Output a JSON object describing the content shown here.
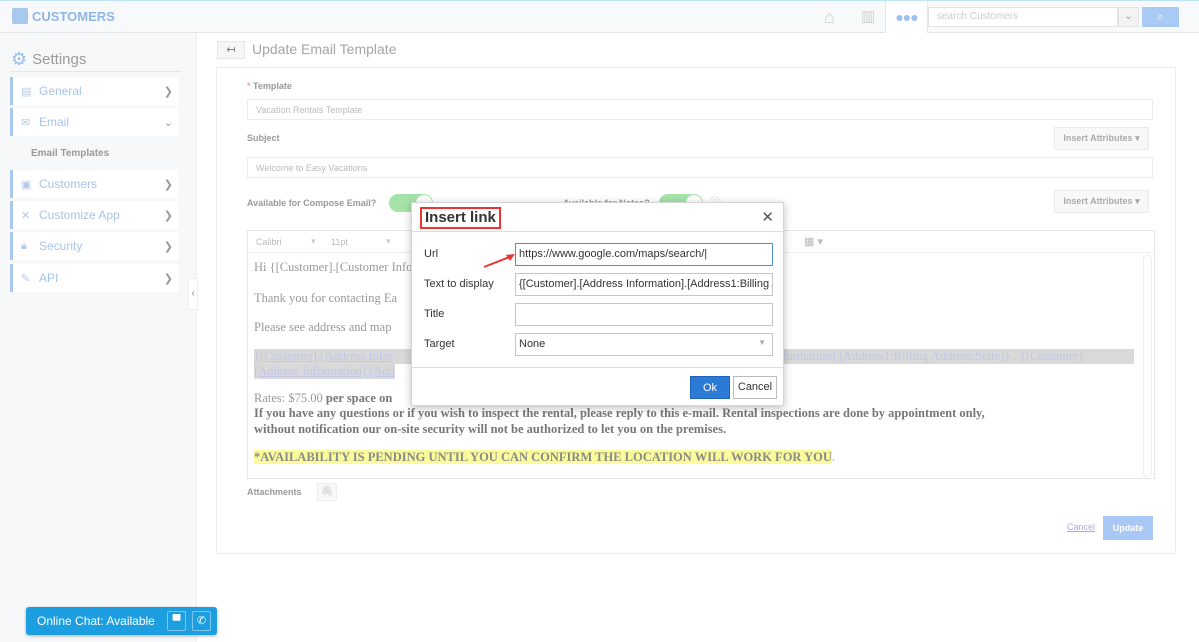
{
  "app": {
    "title": "CUSTOMERS"
  },
  "topbar": {
    "search_placeholder": "search Customers",
    "icons": [
      "home-icon",
      "chart-icon",
      "more-icon",
      "chevron-down-icon",
      "search-icon"
    ]
  },
  "sidebar": {
    "title": "Settings",
    "items": [
      {
        "label": "General",
        "icon": "monitor-icon"
      },
      {
        "label": "Email",
        "icon": "envelope-icon",
        "expanded": true
      },
      {
        "label": "Customers",
        "icon": "customers-icon"
      },
      {
        "label": "Customize App",
        "icon": "tools-icon"
      },
      {
        "label": "Security",
        "icon": "lock-icon"
      },
      {
        "label": "API",
        "icon": "plug-icon"
      }
    ],
    "subitem": "Email Templates"
  },
  "page": {
    "title": "Update Email Template"
  },
  "form": {
    "template_label": "Template",
    "template_value": "Vacation Rentals Template",
    "subject_label": "Subject",
    "subject_value": "Welcome to Easy Vacations",
    "insert_attributes": "Insert Attributes",
    "compose_label": "Available for Compose Email?",
    "compose_on": true,
    "notes_label": "Available for Notes?",
    "notes_on": true,
    "font": "Calibri",
    "size": "11pt",
    "attachments_label": "Attachments",
    "cancel": "Cancel",
    "update": "Update"
  },
  "editor": {
    "line1": "Hi {[Customer].[Customer Info",
    "line2": "Thank you for contacting Ea",
    "line3": "Please see address and map",
    "line4a": "{[Customer].[Address Infor",
    "line4b": "nformation].[Address1:Billing Address:State]} , {[Customer].",
    "line5": "[Address Information].[Add",
    "rates_label": "Rates: ",
    "rates_value": "$75.00",
    "rates_bold": " per space on",
    "line7": "If you have any questions or if you wish to inspect the rental, please reply to this e-mail. Rental inspections are done by appointment only,",
    "line8": "without notification our on-site security will not be authorized to let you on the premises.",
    "notice": "*AVAILABILITY IS PENDING UNTIL YOU CAN CONFIRM THE LOCATION WILL WORK FOR YOU",
    "notice_end": "."
  },
  "modal": {
    "title": "Insert link",
    "url_label": "Url",
    "url_value": "https://www.google.com/maps/search/",
    "text_label": "Text to display",
    "text_value": "{[Customer].[Address Information].[Address1:Billing Address",
    "title_label": "Title",
    "title_value": "",
    "target_label": "Target",
    "target_value": "None",
    "ok": "Ok",
    "cancel": "Cancel"
  },
  "chat": {
    "label": "Online Chat: Available"
  },
  "colors": {
    "accent": "#2b7bd6",
    "chat": "#1d9ee0",
    "highlight_box": "#e33333",
    "toggle_on": "#a5e3a8",
    "notice_bg": "#fbfb9c"
  }
}
